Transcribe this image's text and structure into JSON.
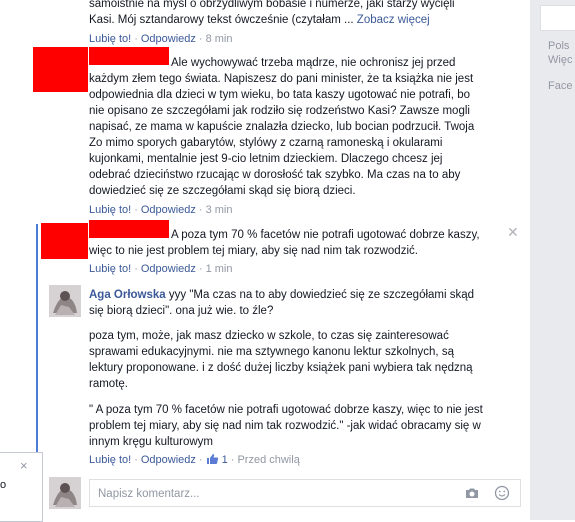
{
  "comments": [
    {
      "lines": [
        "samoistnie na myśl o obrzydliwym bobasie i numerze, jaki starzy wycięli",
        "Kasi. Mój sztandarowy tekst ówcześnie (czytałam ..."
      ],
      "more": "Zobacz więcej",
      "like": "Lubię to!",
      "reply": "Odpowiedz",
      "time": "8 min"
    },
    {
      "lines": [
        "Ale wychowywać trzeba mądrze, nie ochronisz jej przed",
        "każdym złem tego świata. Napiszesz do pani minister, że ta książka nie jest",
        "odpowiednia dla dzieci w tym wieku, bo tata kaszy ugotować nie potrafi, bo",
        "nie opisano ze szczegółami jak rodziło się rodzeństwo Kasi? Zawsze mogli",
        "napisać, ze mama w kapuście znalazła dziecko, lub bocian podrzucił. Twoja",
        "Zo mimo sporych gabarytów, stylówy z czarną ramoneską i okularami",
        "kujonkami, mentalnie jest 9-cio letnim dzieckiem. Dlaczego chcesz jej",
        "odebrać dzieciństwo rzucając w dorosłość tak szybko. Ma czas na to aby",
        "dowiedzieć się ze szczegółami skąd się biorą dzieci."
      ],
      "like": "Lubię to!",
      "reply": "Odpowiedz",
      "time": "3 min"
    },
    {
      "lines": [
        "A poza tym 70 % facetów nie potrafi ugotować dobrze kaszy,",
        "więc to nie jest problem tej miary, aby się nad nim tak rozwodzić."
      ],
      "like": "Lubię to!",
      "reply": "Odpowiedz",
      "time": "1 min"
    },
    {
      "author": "Aga Orłowska",
      "lines": [
        "yyy \"Ma czas na to aby dowiedzieć się ze szczegółami skąd",
        "się biorą dzieci\". ona już wie. to źle?"
      ],
      "para2": [
        "poza tym, może, jak masz dziecko w szkole, to czas się zainteresować",
        "sprawami edukacyjnymi. nie ma sztywnego kanonu lektur szkolnych, są",
        "lektury proponowane. i z dość dużej liczby książek pani wybiera tak nędzną",
        "ramotę."
      ],
      "para3": [
        "\" A poza tym 70 % facetów nie potrafi ugotować dobrze kaszy, więc to nie jest",
        "problem tej miary, aby się nad nim tak rozwodzić.\" -jak widać obracamy się w",
        "innym kręgu kulturowym"
      ],
      "like": "Lubię to!",
      "reply": "Odpowiedz",
      "likes_count": "1",
      "time": "Przed chwilą"
    }
  ],
  "composer": {
    "placeholder": "Napisz komentarz..."
  },
  "sidebar": {
    "line1": "Pols",
    "line2": "Więc",
    "line3": "Face"
  },
  "popup": {
    "close": "×",
    "text": "o"
  },
  "colors": {
    "link": "#3b5998",
    "redaction": "#ff0000",
    "thread_line": "#4c7dd4"
  },
  "icons": [
    "close-icon",
    "like-thumb-icon",
    "camera-icon",
    "emoji-icon"
  ]
}
